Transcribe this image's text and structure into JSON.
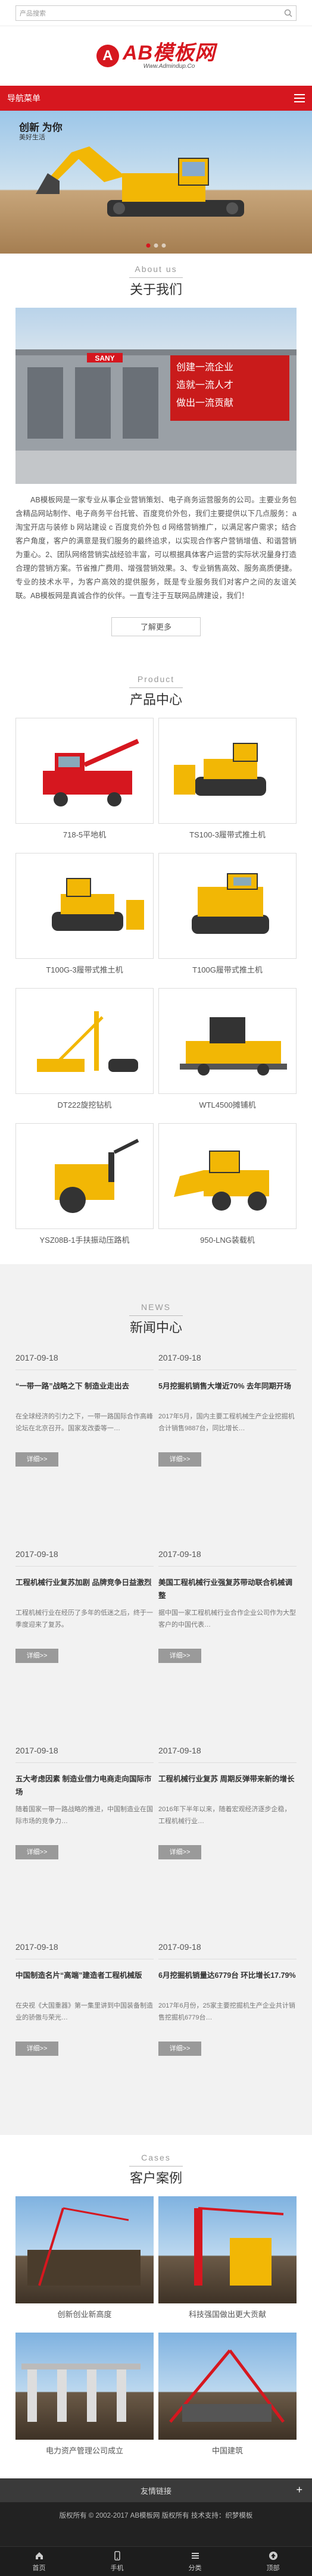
{
  "header": {
    "search_placeholder": "产品搜索",
    "logo_mark": "A",
    "logo_title": "AB模板网",
    "logo_sub": "Www.Admindup.Co",
    "nav_label": "导航菜单"
  },
  "banner": {
    "headline": "创新 为你",
    "subline": "美好生活"
  },
  "about": {
    "en": "About us",
    "cn": "关于我们",
    "building_sign": "SANY",
    "board_text_1": "创建一流企业",
    "board_text_2": "造就一流人才",
    "board_text_3": "做出一流贡献",
    "body": "AB模板网是一家专业从事企业营销策划、电子商务运营服务的公司。主要业务包含精品网站制作、电子商务平台托管、百度竞价外包，我们主要提供以下几点服务：a 淘宝开店与装修 b 网站建设 c 百度竞价外包 d 网络营销推广，以满足客户需求；结合客户角度，客户的满意是我们服务的最终追求，以实现合作客户营销增值、和谐营销为重心。2、团队网络营销实战经验丰富，可以根据具体客户运营的实际状况量身打造合理的营销方案。节省推广费用、增强营销效果。3、专业销售高效、服务高质便捷。专业的技术水平，为客户高效的提供服务，既是专业服务我们对客户之间的友谊关联。AB模板网是真诚合作的伙伴。一直专注于互联网品牌建设，我们！",
    "more_label": "了解更多"
  },
  "products": {
    "en": "Product",
    "cn": "产品中心",
    "items": [
      {
        "name": "718-5平地机"
      },
      {
        "name": "TS100-3履带式推土机"
      },
      {
        "name": "T100G-3履带式推土机"
      },
      {
        "name": "T100G履带式推土机"
      },
      {
        "name": "DT222旋挖钻机"
      },
      {
        "name": "WTL4500摊铺机"
      },
      {
        "name": "YSZ08B-1手扶振动压路机"
      },
      {
        "name": "950-LNG装载机"
      }
    ]
  },
  "news": {
    "en": "NEWS",
    "cn": "新闻中心",
    "more_label": "详细>>",
    "items": [
      {
        "date": "2017-09-18",
        "title": "“一带一路”战略之下 制造业走出去",
        "desc": "在全球经济的引力之下，一带一路国际合作高峰论坛在北京召开。国家发改委等一…"
      },
      {
        "date": "2017-09-18",
        "title": "5月挖掘机销售大增近70% 去年同期开场",
        "desc": "2017年5月，国内主要工程机械生产企业挖掘机合计销售9887台，同比增长…"
      },
      {
        "date": "2017-09-18",
        "title": "工程机械行业复苏加剧 品牌竞争日益激烈",
        "desc": "工程机械行业在经历了多年的低迷之后，终于一季度迎来了复苏。"
      },
      {
        "date": "2017-09-18",
        "title": "美国工程机械行业强复苏带动联合机械调整",
        "desc": "据中国一家工程机械行业合作企业公司作为大型客户的中国代表…"
      },
      {
        "date": "2017-09-18",
        "title": "五大考虑因素 制造业借力电商走向国际市场",
        "desc": "随着国家一带一路战略的推进，中国制造业在国际市场的竞争力…"
      },
      {
        "date": "2017-09-18",
        "title": "工程机械行业复苏 周期反弹带来新的增长",
        "desc": "2016年下半年以来，随着宏观经济逐步企稳，工程机械行业…"
      },
      {
        "date": "2017-09-18",
        "title": "中国制造名片“高端”建造者工程机械版",
        "desc": "在央视《大国重器》第一集里讲到中国装备制造业的骄傲与荣光…"
      },
      {
        "date": "2017-09-18",
        "title": "6月挖掘机销量达6779台 环比增长17.79%",
        "desc": "2017年6月份，25家主要挖掘机生产企业共计销售挖掘机6779台…"
      }
    ]
  },
  "cases": {
    "en": "Cases",
    "cn": "客户案例",
    "items": [
      {
        "name": "创新创业新高度"
      },
      {
        "name": "科技强国做出更大贡献"
      },
      {
        "name": "电力资产管理公司成立"
      },
      {
        "name": "中国建筑"
      }
    ]
  },
  "footer": {
    "links_label": "友情链接",
    "copyright": "版权所有 © 2002-2017 AB模板网 版权所有 技术支持：织梦模板",
    "tabs": [
      {
        "label": "首页"
      },
      {
        "label": "手机"
      },
      {
        "label": "分类"
      },
      {
        "label": "顶部"
      }
    ]
  },
  "colors": {
    "brand": "#d6171f"
  }
}
